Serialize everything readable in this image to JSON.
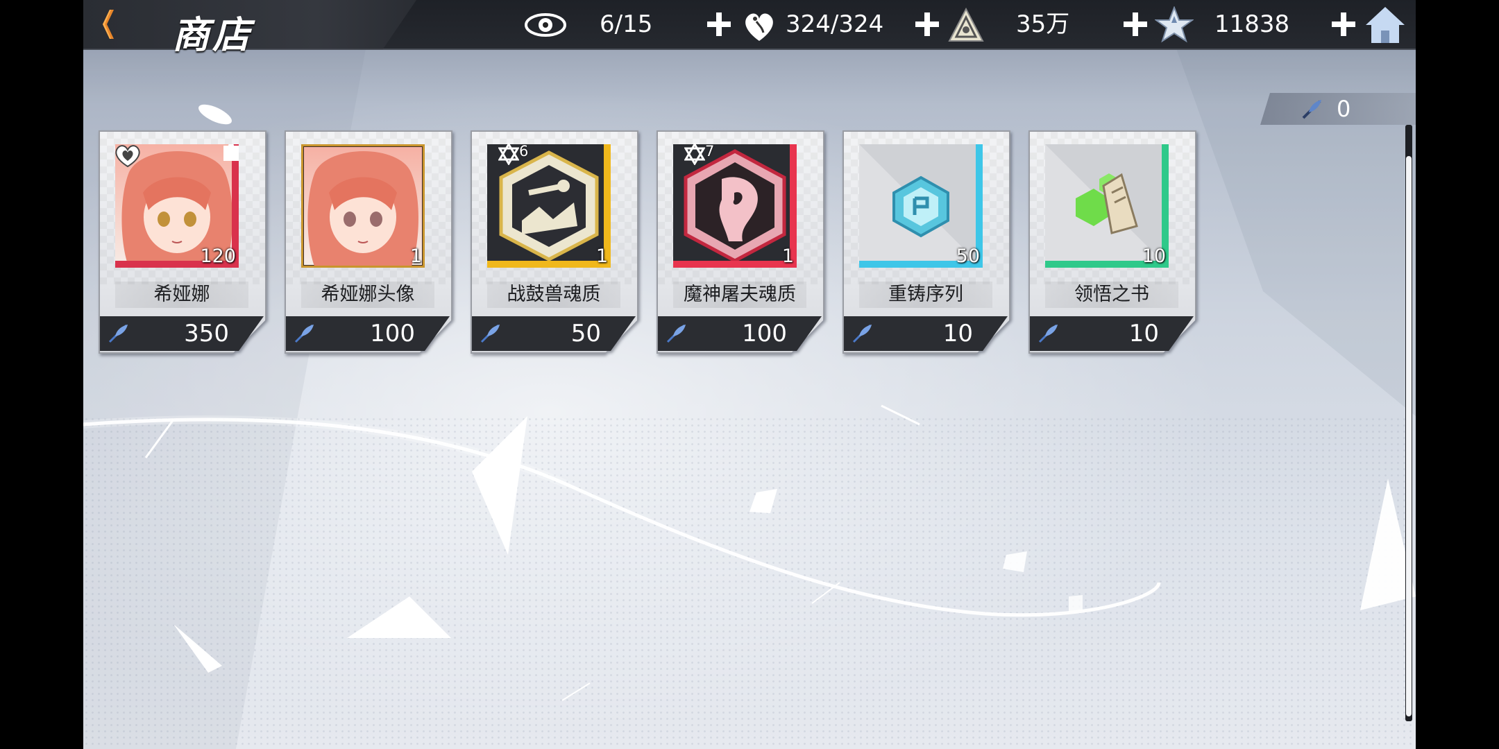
{
  "header": {
    "title": "商店",
    "resources": [
      {
        "icon": "eye-icon",
        "value": "6/15"
      },
      {
        "icon": "heart-icon",
        "value": "324/324"
      },
      {
        "icon": "triangle-emblem-icon",
        "value": "35万"
      },
      {
        "icon": "crystal-star-icon",
        "value": "11838"
      }
    ]
  },
  "shop_currency": {
    "icon": "feather-quill-icon",
    "value": "0"
  },
  "items": [
    {
      "name": "希娅娜",
      "qty": "120",
      "price": "350",
      "icon": "character-portrait-icon",
      "rarity_color": "#d9324c"
    },
    {
      "name": "希娅娜头像",
      "qty": "1",
      "price": "100",
      "icon": "avatar-frame-icon",
      "rarity_color": "#c9952d"
    },
    {
      "name": "战鼓兽魂质",
      "qty": "1",
      "price": "50",
      "star": "6",
      "icon": "war-drum-soul-icon",
      "rarity_color": "#f0b81c"
    },
    {
      "name": "魔神屠夫魂质",
      "qty": "1",
      "price": "100",
      "star": "7",
      "icon": "demon-butcher-soul-icon",
      "rarity_color": "#e8344e"
    },
    {
      "name": "重铸序列",
      "qty": "50",
      "price": "10",
      "icon": "reforge-crystal-icon",
      "rarity_color": "#3ec6e8"
    },
    {
      "name": "领悟之书",
      "qty": "10",
      "price": "10",
      "icon": "insight-book-icon",
      "rarity_color": "#2fc98a"
    }
  ]
}
